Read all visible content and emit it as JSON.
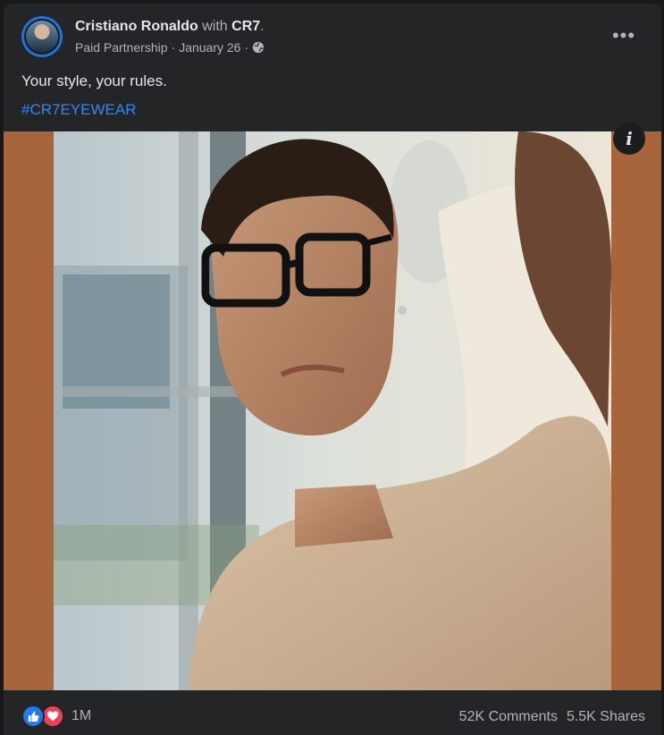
{
  "post": {
    "author": "Cristiano Ronaldo",
    "with_text": "with",
    "partner": "CR7",
    "partner_suffix": ".",
    "paid_label": "Paid Partnership",
    "separator": "·",
    "date": "January 26",
    "privacy_icon": "globe-icon",
    "caption": "Your style, your rules.",
    "hashtag": "#CR7EYEWEAR",
    "more_icon": "more-horizontal-icon",
    "more_label": "•••",
    "info_icon": "info-icon",
    "info_label": "i"
  },
  "media": {
    "description": "photo-post-image",
    "frame_color": "#a8643a"
  },
  "engagement": {
    "reaction_icons": [
      "like-reaction-icon",
      "love-reaction-icon"
    ],
    "reaction_count": "1M",
    "comments": "52K Comments",
    "shares": "5.5K Shares"
  },
  "colors": {
    "background": "#18191a",
    "card": "#242526",
    "text_primary": "#e4e6eb",
    "text_secondary": "#b0b3b8",
    "link": "#2d88ff",
    "like": "#2078f4",
    "love": "#f33e58"
  }
}
